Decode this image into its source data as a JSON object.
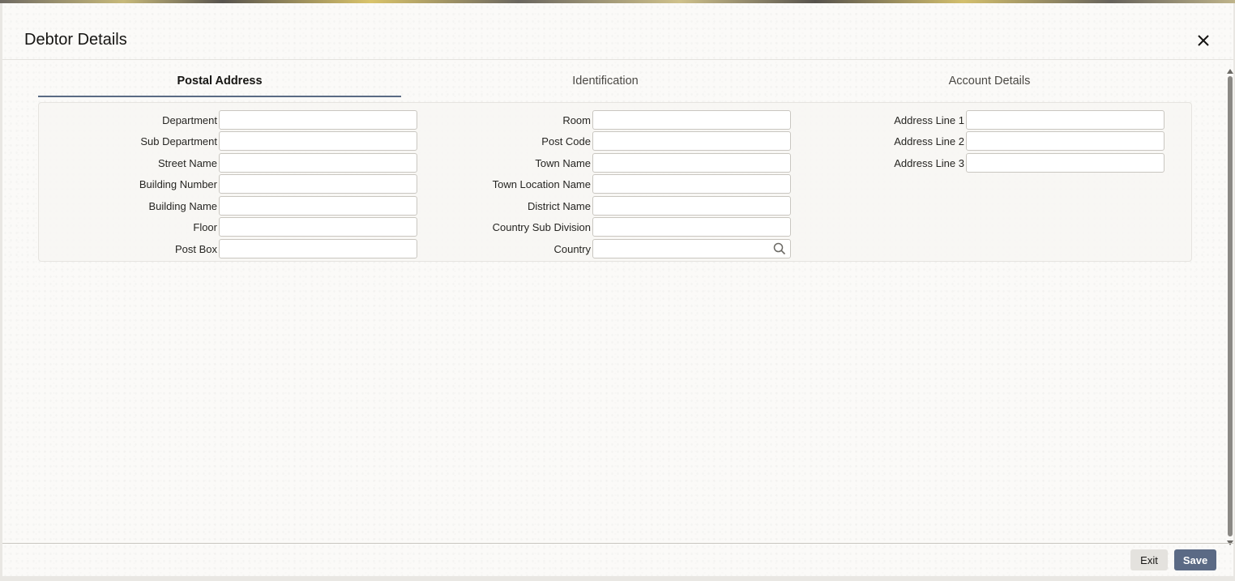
{
  "dialog": {
    "title": "Debtor Details"
  },
  "tabs": [
    {
      "label": "Postal Address",
      "active": true
    },
    {
      "label": "Identification",
      "active": false
    },
    {
      "label": "Account Details",
      "active": false
    }
  ],
  "postal_address": {
    "column1": [
      {
        "label": "Department",
        "value": ""
      },
      {
        "label": "Sub Department",
        "value": ""
      },
      {
        "label": "Street Name",
        "value": ""
      },
      {
        "label": "Building Number",
        "value": ""
      },
      {
        "label": "Building Name",
        "value": ""
      },
      {
        "label": "Floor",
        "value": ""
      },
      {
        "label": "Post Box",
        "value": ""
      }
    ],
    "column2": [
      {
        "label": "Room",
        "value": ""
      },
      {
        "label": "Post Code",
        "value": ""
      },
      {
        "label": "Town Name",
        "value": ""
      },
      {
        "label": "Town Location Name",
        "value": ""
      },
      {
        "label": "District Name",
        "value": ""
      },
      {
        "label": "Country Sub Division",
        "value": ""
      },
      {
        "label": "Country",
        "value": "",
        "has_lookup": true
      }
    ],
    "column3": [
      {
        "label": "Address Line 1",
        "value": ""
      },
      {
        "label": "Address Line 2",
        "value": ""
      },
      {
        "label": "Address Line 3",
        "value": ""
      }
    ]
  },
  "footer": {
    "exit_label": "Exit",
    "save_label": "Save"
  },
  "icons": {
    "close": "close-icon",
    "lookup": "search-icon"
  },
  "colors": {
    "accent": "#5b6a85",
    "tab_underline": "#5a6b84"
  }
}
